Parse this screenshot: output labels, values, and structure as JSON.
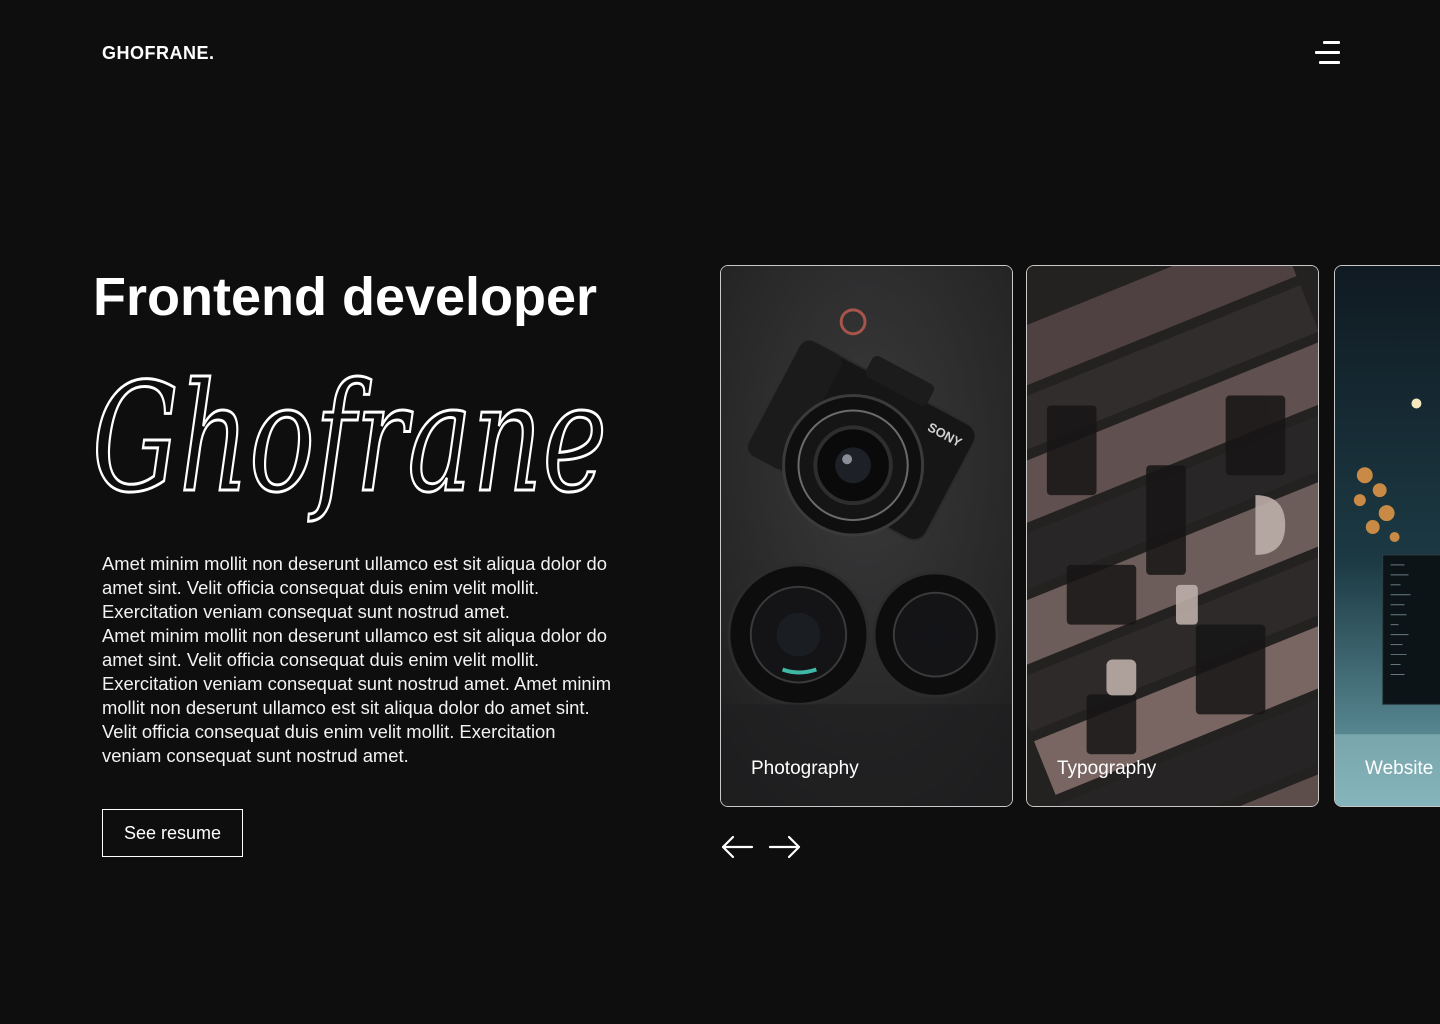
{
  "header": {
    "logo": "GHOFRANE.",
    "menu_icon": "hamburger-menu-icon"
  },
  "hero": {
    "role": "Frontend developer",
    "signature": "Ghofrane",
    "bio_lines": [
      "Amet minim mollit non deserunt ullamco est sit aliqua dolor do amet sint. Velit officia consequat duis enim velit mollit. Exercitation veniam consequat sunt nostrud amet.",
      "Amet minim mollit non deserunt ullamco est sit aliqua dolor do amet sint. Velit officia consequat duis enim velit mollit. Exercitation veniam consequat sunt nostrud amet. Amet minim mollit non deserunt ullamco est sit aliqua dolor do amet sint. Velit officia consequat duis enim velit mollit. Exercitation veniam consequat sunt nostrud amet."
    ],
    "resume_label": "See resume"
  },
  "carousel": {
    "cards": [
      {
        "label": "Photography",
        "image": "camera-photo"
      },
      {
        "label": "Typography",
        "image": "letterpress-type-photo"
      },
      {
        "label": "Website",
        "image": "office-computer-photo"
      }
    ],
    "prev_icon": "arrow-left-icon",
    "next_icon": "arrow-right-icon"
  },
  "colors": {
    "background": "#0e0e0f",
    "text": "#ffffff",
    "card_border": "#c9c9c9"
  }
}
